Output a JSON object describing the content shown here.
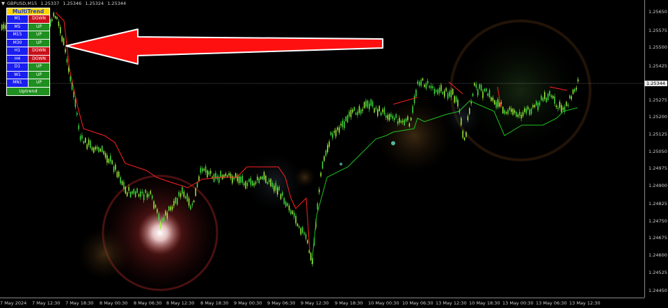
{
  "header": {
    "symbol": "GBPUSD,M15",
    "open": "1.25337",
    "high": "1.25346",
    "low": "1.25324",
    "close": "1.25344"
  },
  "price_axis": {
    "labels": [
      "1.25650",
      "1.25575",
      "1.25500",
      "1.25425",
      "1.25344",
      "1.25275",
      "1.25200",
      "1.25125",
      "1.25050",
      "1.24975",
      "1.24900",
      "1.24825",
      "1.24750",
      "1.24675",
      "1.24600",
      "1.24525",
      "1.24450"
    ],
    "current_price": "1.25344"
  },
  "time_axis": {
    "labels": [
      "7 May 2024",
      "7 May 12:30",
      "7 May 18:30",
      "8 May 00:30",
      "8 May 06:30",
      "8 May 12:30",
      "8 May 18:30",
      "9 May 00:30",
      "9 May 06:30",
      "9 May 12:30",
      "9 May 18:30",
      "10 May 00:30",
      "10 May 06:30",
      "13 May 12:30",
      "10 May 18:30",
      "13 May 00:30",
      "13 May 06:30",
      "13 May 12:30"
    ]
  },
  "multitrend": {
    "title": "MultiTrend",
    "rows": [
      {
        "tf": "M1",
        "dir": "DOWN"
      },
      {
        "tf": "M5",
        "dir": "UP"
      },
      {
        "tf": "M15",
        "dir": "UP"
      },
      {
        "tf": "M30",
        "dir": "UP"
      },
      {
        "tf": "H1",
        "dir": "DOWN"
      },
      {
        "tf": "H4",
        "dir": "DOWN"
      },
      {
        "tf": "D1",
        "dir": "UP"
      },
      {
        "tf": "W1",
        "dir": "UP"
      },
      {
        "tf": "MN1",
        "dir": "UP"
      }
    ],
    "summary": "Uptrend"
  },
  "colors": {
    "bull": "#3fe03f",
    "bear": "#9ef03a",
    "stop_down": "#ff2020",
    "stop_up": "#1fc01f",
    "arrow": "#ff1010"
  }
}
